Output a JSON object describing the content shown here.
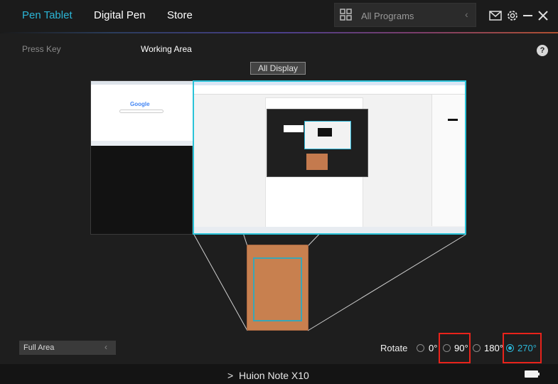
{
  "header": {
    "tabs": [
      {
        "label": "Pen Tablet",
        "active": true
      },
      {
        "label": "Digital Pen",
        "active": false
      },
      {
        "label": "Store",
        "active": false
      }
    ],
    "program_selector": {
      "value": "All Programs",
      "icon": "grid-icon"
    },
    "icons": [
      "mail-icon",
      "gear-icon",
      "minimize-icon",
      "close-icon"
    ]
  },
  "subnav": {
    "press_key": "Press Key",
    "working_area": "Working Area",
    "help": "?"
  },
  "display_selector": {
    "label": "All Display"
  },
  "screen_mapping": {
    "left_monitor_search_logo": "Google"
  },
  "area": {
    "value": "Full Area"
  },
  "rotate": {
    "label": "Rotate",
    "options": [
      "0°",
      "90°",
      "180°",
      "270°"
    ],
    "selected": "270°",
    "highlighted": [
      "90°",
      "270°"
    ]
  },
  "footer": {
    "device": "Huion Note X10",
    "chevron": ">"
  },
  "colors": {
    "accent": "#2bb5d6",
    "tablet": "#c8804f",
    "highlight": "#e8231b"
  }
}
